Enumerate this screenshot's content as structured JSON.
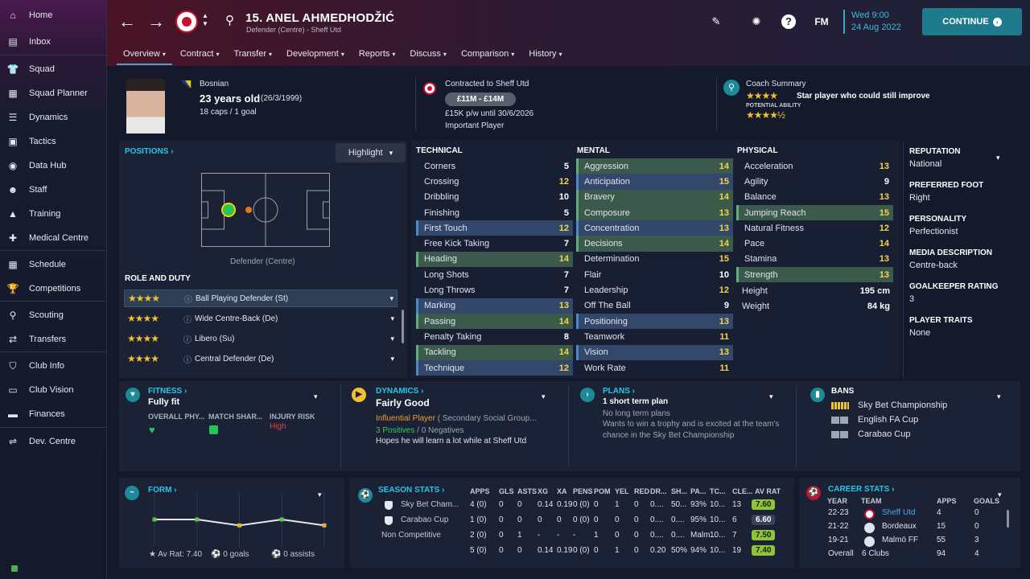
{
  "sidebar": {
    "items": [
      {
        "label": "Home",
        "icon": "home-icon"
      },
      {
        "label": "Inbox",
        "icon": "inbox-icon"
      },
      {
        "label": "Squad",
        "icon": "shirt-icon"
      },
      {
        "label": "Squad Planner",
        "icon": "clipboard-icon"
      },
      {
        "label": "Dynamics",
        "icon": "dynamics-icon"
      },
      {
        "label": "Tactics",
        "icon": "tactics-board-icon"
      },
      {
        "label": "Data Hub",
        "icon": "data-hub-icon"
      },
      {
        "label": "Staff",
        "icon": "staff-icon"
      },
      {
        "label": "Training",
        "icon": "training-cone-icon"
      },
      {
        "label": "Medical Centre",
        "icon": "medical-kit-icon"
      },
      {
        "label": "Schedule",
        "icon": "calendar-icon"
      },
      {
        "label": "Competitions",
        "icon": "trophy-icon"
      },
      {
        "label": "Scouting",
        "icon": "magnifier-icon"
      },
      {
        "label": "Transfers",
        "icon": "transfer-arrows-icon"
      },
      {
        "label": "Club Info",
        "icon": "shield-icon"
      },
      {
        "label": "Club Vision",
        "icon": "briefcase-icon"
      },
      {
        "label": "Finances",
        "icon": "money-icon"
      },
      {
        "label": "Dev. Centre",
        "icon": "dev-centre-icon"
      }
    ]
  },
  "header": {
    "player_title": "15. ANEL AHMEDHODŽIĆ",
    "player_sub": "Defender (Centre) - Sheff Utd",
    "fm_label": "FM",
    "date_day": "Wed 9:00",
    "date_full": "24 Aug 2022",
    "continue_label": "CONTINUE",
    "tabs": [
      "Overview",
      "Contract",
      "Transfer",
      "Development",
      "Reports",
      "Discuss",
      "Comparison",
      "History"
    ]
  },
  "profile": {
    "nationality": "Bosnian",
    "age": "23 years old",
    "dob": "(26/3/1999)",
    "caps": "18 caps / 1 goal",
    "contract_label": "Contracted to Sheff Utd",
    "value": "£11M - £14M",
    "wage": "£15K p/w until 30/6/2026",
    "status": "Important Player",
    "coach_label": "Coach Summary",
    "coach_text": "Star player who could still improve",
    "potential_label": "POTENTIAL ABILITY",
    "current_stars": "★★★★",
    "potential_stars": "★★★★½"
  },
  "positions": {
    "label": "POSITIONS",
    "highlight": "Highlight",
    "position_name": "Defender (Centre)",
    "role_duty_label": "ROLE AND DUTY",
    "roles": [
      {
        "name": "Ball Playing Defender (St)",
        "stars": "★★★★"
      },
      {
        "name": "Wide Centre-Back (De)",
        "stars": "★★★★"
      },
      {
        "name": "Libero (Su)",
        "stars": "★★★★"
      },
      {
        "name": "Central Defender (De)",
        "stars": "★★★★"
      }
    ]
  },
  "technical": {
    "label": "TECHNICAL",
    "rows": [
      {
        "name": "Corners",
        "value": "5"
      },
      {
        "name": "Crossing",
        "value": "12"
      },
      {
        "name": "Dribbling",
        "value": "10"
      },
      {
        "name": "Finishing",
        "value": "5"
      },
      {
        "name": "First Touch",
        "value": "12"
      },
      {
        "name": "Free Kick Taking",
        "value": "7"
      },
      {
        "name": "Heading",
        "value": "14"
      },
      {
        "name": "Long Shots",
        "value": "7"
      },
      {
        "name": "Long Throws",
        "value": "7"
      },
      {
        "name": "Marking",
        "value": "13"
      },
      {
        "name": "Passing",
        "value": "14"
      },
      {
        "name": "Penalty Taking",
        "value": "8"
      },
      {
        "name": "Tackling",
        "value": "14"
      },
      {
        "name": "Technique",
        "value": "12"
      }
    ]
  },
  "mental": {
    "label": "MENTAL",
    "rows": [
      {
        "name": "Aggression",
        "value": "14"
      },
      {
        "name": "Anticipation",
        "value": "15"
      },
      {
        "name": "Bravery",
        "value": "14"
      },
      {
        "name": "Composure",
        "value": "13"
      },
      {
        "name": "Concentration",
        "value": "13"
      },
      {
        "name": "Decisions",
        "value": "14"
      },
      {
        "name": "Determination",
        "value": "15"
      },
      {
        "name": "Flair",
        "value": "10"
      },
      {
        "name": "Leadership",
        "value": "12"
      },
      {
        "name": "Off The Ball",
        "value": "9"
      },
      {
        "name": "Positioning",
        "value": "13"
      },
      {
        "name": "Teamwork",
        "value": "11"
      },
      {
        "name": "Vision",
        "value": "13"
      },
      {
        "name": "Work Rate",
        "value": "11"
      }
    ]
  },
  "physical": {
    "label": "PHYSICAL",
    "rows": [
      {
        "name": "Acceleration",
        "value": "13"
      },
      {
        "name": "Agility",
        "value": "9"
      },
      {
        "name": "Balance",
        "value": "13"
      },
      {
        "name": "Jumping Reach",
        "value": "15"
      },
      {
        "name": "Natural Fitness",
        "value": "12"
      },
      {
        "name": "Pace",
        "value": "14"
      },
      {
        "name": "Stamina",
        "value": "13"
      },
      {
        "name": "Strength",
        "value": "13"
      }
    ],
    "height_label": "Height",
    "height": "195 cm",
    "weight_label": "Weight",
    "weight": "84 kg"
  },
  "info": {
    "reputation_label": "REPUTATION",
    "reputation": "National",
    "foot_label": "PREFERRED FOOT",
    "foot": "Right",
    "personality_label": "PERSONALITY",
    "personality": "Perfectionist",
    "media_label": "MEDIA DESCRIPTION",
    "media": "Centre-back",
    "gk_label": "GOALKEEPER RATING",
    "gk": "3",
    "traits_label": "PLAYER TRAITS",
    "traits": "None"
  },
  "fitness": {
    "label": "FITNESS",
    "status": "Fully fit",
    "col1": "OVERALL PHY...",
    "col2": "MATCH SHAR...",
    "col3": "INJURY RISK",
    "risk": "High"
  },
  "dynamics": {
    "label": "DYNAMICS",
    "status": "Fairly Good",
    "influence": "Influential Player",
    "group": "( Secondary Social Group...",
    "positives": "3 Positives",
    "negatives": "/ 0 Negatives",
    "hope": "Hopes he will learn a lot while at Sheff Utd"
  },
  "plans": {
    "label": "PLANS",
    "short": "1 short term plan",
    "long": "No long term plans",
    "desc1": "Wants to win a trophy and is excited at the team's",
    "desc2": "chance in the Sky Bet Championship"
  },
  "bans": {
    "label": "BANS",
    "comps": [
      "Sky Bet Championship",
      "English FA Cup",
      "Carabao Cup"
    ]
  },
  "form": {
    "label": "FORM",
    "av_rat": "Av Rat: 7.40",
    "goals": "0 goals",
    "assists": "0 assists",
    "chart_data": {
      "type": "line",
      "values": [
        7.6,
        7.6,
        7.5,
        7.6,
        7.5
      ],
      "ylim": [
        7.3,
        7.9
      ]
    }
  },
  "season": {
    "label": "SEASON STATS",
    "headers": [
      "APPS",
      "GLS",
      "ASTS",
      "XG",
      "XA",
      "PENS",
      "POM",
      "YEL",
      "RED",
      "DR...",
      "SH...",
      "PA...",
      "TC...",
      "CLE...",
      "AV RAT"
    ],
    "rows": [
      {
        "comp": "Sky Bet Cham...",
        "cells": [
          "4 (0)",
          "0",
          "0",
          "0.14",
          "0.19",
          "0 (0)",
          "0",
          "1",
          "0",
          "0....",
          "50...",
          "93%",
          "10...",
          "13"
        ],
        "rating": "7.60"
      },
      {
        "comp": "Carabao Cup",
        "cells": [
          "1 (0)",
          "0",
          "0",
          "0",
          "0",
          "0 (0)",
          "0",
          "0",
          "0",
          "0....",
          "0....",
          "95%",
          "10...",
          "6"
        ],
        "rating": "6.60"
      },
      {
        "comp": "Non Competitive",
        "cells": [
          "2 (0)",
          "0",
          "1",
          "-",
          "-",
          "-",
          "1",
          "0",
          "0",
          "0....",
          "0....",
          "Malm...",
          "10...",
          "7"
        ],
        "rating": "7.50"
      },
      {
        "comp": "",
        "cells": [
          "5 (0)",
          "0",
          "0",
          "0.14",
          "0.19",
          "0 (0)",
          "0",
          "1",
          "0",
          "0.20",
          "50%",
          "94%",
          "10...",
          "19"
        ],
        "rating": "7.40"
      }
    ]
  },
  "career": {
    "label": "CAREER STATS",
    "headers": [
      "YEAR",
      "TEAM",
      "APPS",
      "GOALS"
    ],
    "rows": [
      {
        "year": "22-23",
        "team": "Sheff Utd",
        "apps": "4",
        "goals": "0"
      },
      {
        "year": "21-22",
        "team": "Bordeaux",
        "apps": "15",
        "goals": "0"
      },
      {
        "year": "19-21",
        "team": "Malmö FF",
        "apps": "55",
        "goals": "3"
      }
    ],
    "overall_label": "Overall",
    "overall_team": "6 Clubs",
    "overall_apps": "94",
    "overall_goals": "4"
  },
  "colors": {
    "accent": "#28c6e6",
    "continue": "#1f7a8c",
    "good_attr": "#3c5a4c",
    "key_attr": "#33476a",
    "rating_good": "#8ec43a"
  }
}
